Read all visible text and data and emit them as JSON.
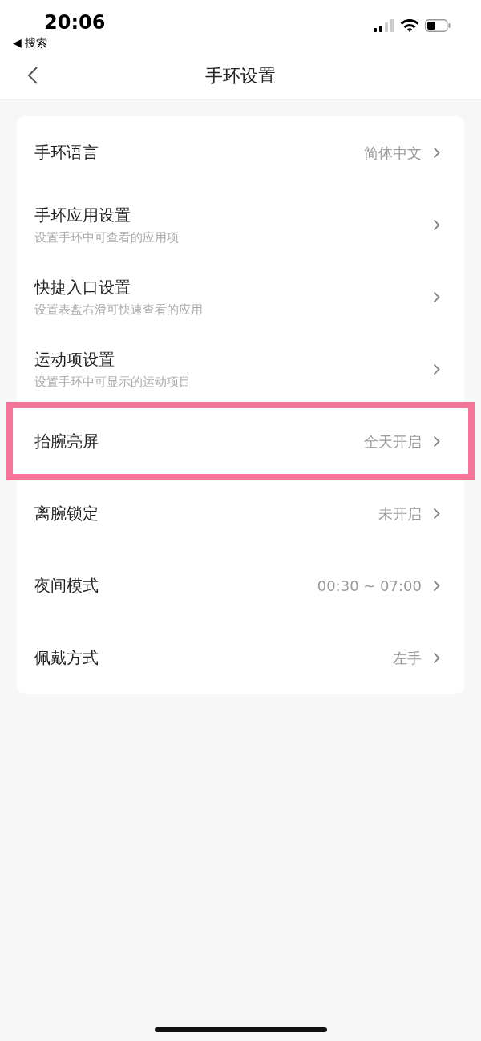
{
  "status_bar": {
    "time": "20:06",
    "back_label": "◀ 搜索"
  },
  "nav": {
    "title": "手环设置"
  },
  "items": [
    {
      "label": "手环语言",
      "value": "简体中文",
      "highlighted": false
    },
    {
      "label": "手环应用设置",
      "subtitle": "设置手环中可查看的应用项",
      "highlighted": false
    },
    {
      "label": "快捷入口设置",
      "subtitle": "设置表盘右滑可快速查看的应用",
      "highlighted": false
    },
    {
      "label": "运动项设置",
      "subtitle": "设置手环中可显示的运动项目",
      "highlighted": false
    },
    {
      "label": "抬腕亮屏",
      "value": "全天开启",
      "highlighted": true
    },
    {
      "label": "离腕锁定",
      "value": "未开启",
      "highlighted": false
    },
    {
      "label": "夜间模式",
      "value": "00:30 ~ 07:00",
      "highlighted": false
    },
    {
      "label": "佩戴方式",
      "value": "左手",
      "highlighted": false
    }
  ]
}
